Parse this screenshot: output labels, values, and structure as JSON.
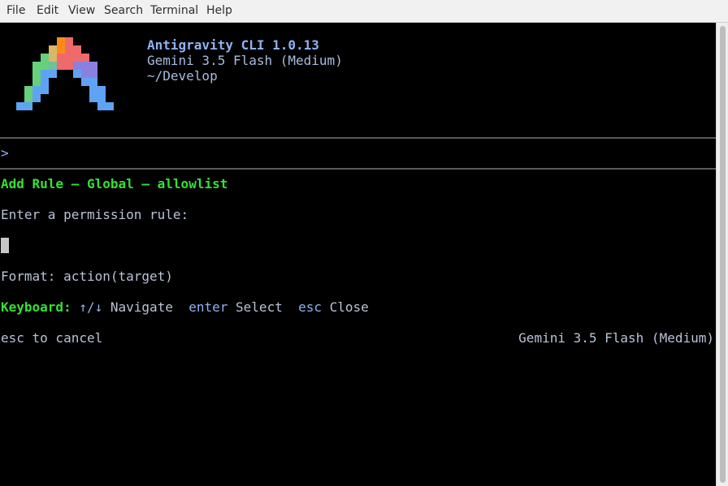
{
  "menu": {
    "file": "File",
    "edit": "Edit",
    "view": "View",
    "search": "Search",
    "terminal": "Terminal",
    "help": "Help"
  },
  "header": {
    "title": "Antigravity CLI 1.0.13",
    "model": "Gemini 3.5 Flash (Medium)",
    "path": "~/Develop"
  },
  "prompt": {
    "symbol": ">"
  },
  "dialog": {
    "title": "Add Rule — Global — allowlist",
    "instruction": "Enter a permission rule:",
    "format": "Format: action(target)"
  },
  "keyboard": {
    "label": "Keyboard:",
    "nav_key": "↑/↓",
    "nav_text": "Navigate",
    "enter_key": "enter",
    "enter_text": "Select",
    "esc_key": "esc",
    "esc_text": "Close"
  },
  "status": {
    "left": "esc to cancel",
    "right": "Gemini 3.5 Flash (Medium)"
  },
  "colors": {
    "logo_orange": "#ff8a1a",
    "logo_red": "#ef6a6a",
    "logo_purple": "#8b7fe0",
    "logo_green": "#66d07a",
    "logo_blue": "#5fa3f5",
    "accent_green": "#34e034",
    "accent_blue": "#8fb2f2"
  }
}
